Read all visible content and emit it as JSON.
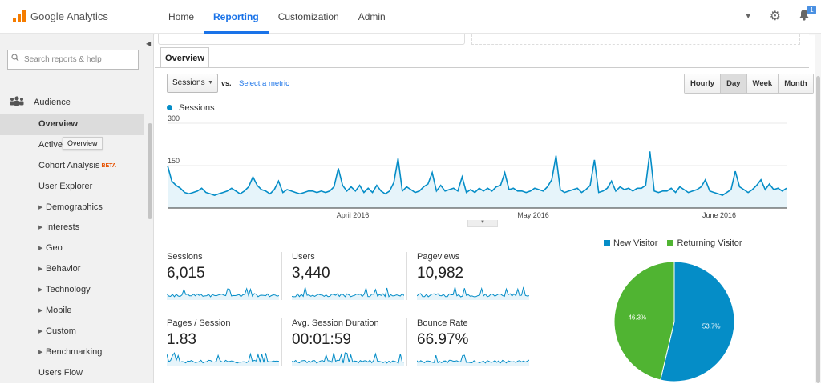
{
  "app": {
    "logo_text": "Google Analytics"
  },
  "nav": [
    {
      "label": "Home",
      "active": false
    },
    {
      "label": "Reporting",
      "active": true
    },
    {
      "label": "Customization",
      "active": false
    },
    {
      "label": "Admin",
      "active": false
    }
  ],
  "header": {
    "notification_count": "1"
  },
  "sidebar": {
    "search_placeholder": "Search reports & help",
    "section": "Audience",
    "items": [
      {
        "label": "Overview",
        "selected": true,
        "expandable": false
      },
      {
        "label": "Active",
        "selected": false,
        "expandable": false
      },
      {
        "label": "Cohort Analysis",
        "badge": "BETA",
        "selected": false,
        "expandable": false
      },
      {
        "label": "User Explorer",
        "selected": false,
        "expandable": false
      },
      {
        "label": "Demographics",
        "selected": false,
        "expandable": true
      },
      {
        "label": "Interests",
        "selected": false,
        "expandable": true
      },
      {
        "label": "Geo",
        "selected": false,
        "expandable": true
      },
      {
        "label": "Behavior",
        "selected": false,
        "expandable": true
      },
      {
        "label": "Technology",
        "selected": false,
        "expandable": true
      },
      {
        "label": "Mobile",
        "selected": false,
        "expandable": true
      },
      {
        "label": "Custom",
        "selected": false,
        "expandable": true
      },
      {
        "label": "Benchmarking",
        "selected": false,
        "expandable": true
      },
      {
        "label": "Users Flow",
        "selected": false,
        "expandable": false
      }
    ],
    "tooltip": "Overview"
  },
  "report": {
    "tab": "Overview",
    "metric_select": "Sessions",
    "vs_label": "vs.",
    "select_metric_link": "Select a metric",
    "periods": [
      {
        "label": "Hourly",
        "active": false
      },
      {
        "label": "Day",
        "active": true
      },
      {
        "label": "Week",
        "active": false
      },
      {
        "label": "Month",
        "active": false
      }
    ],
    "legend": "Sessions"
  },
  "chart_data": [
    {
      "type": "area",
      "series": [
        {
          "name": "Sessions",
          "values": [
            150,
            95,
            80,
            70,
            55,
            50,
            55,
            60,
            70,
            55,
            50,
            45,
            50,
            55,
            60,
            70,
            60,
            50,
            60,
            75,
            110,
            80,
            65,
            60,
            50,
            65,
            95,
            55,
            65,
            60,
            55,
            50,
            55,
            60,
            60,
            55,
            60,
            55,
            60,
            75,
            140,
            80,
            60,
            75,
            60,
            80,
            55,
            70,
            55,
            80,
            60,
            50,
            60,
            90,
            175,
            60,
            75,
            65,
            55,
            60,
            75,
            85,
            125,
            60,
            80,
            60,
            65,
            70,
            60,
            110,
            55,
            65,
            55,
            70,
            60,
            70,
            60,
            75,
            80,
            125,
            65,
            70,
            60,
            60,
            55,
            60,
            70,
            65,
            60,
            75,
            100,
            185,
            65,
            55,
            60,
            65,
            70,
            55,
            65,
            80,
            170,
            55,
            60,
            70,
            95,
            60,
            75,
            65,
            70,
            60,
            70,
            70,
            80,
            200,
            60,
            55,
            60,
            60,
            70,
            55,
            75,
            65,
            55,
            60,
            65,
            75,
            100,
            60,
            55,
            50,
            45,
            55,
            65,
            130,
            75,
            65,
            55,
            65,
            80,
            100,
            65,
            85,
            65,
            70,
            60,
            70
          ]
        }
      ],
      "ylim": [
        0,
        300
      ],
      "yticks": [
        "300",
        "150"
      ],
      "x_tick_labels": [
        "April 2016",
        "May 2016",
        "June 2016"
      ],
      "legend": "top-left"
    },
    {
      "type": "pie",
      "categories": [
        "New Visitor",
        "Returning Visitor"
      ],
      "values": [
        53.7,
        46.3
      ],
      "labels": [
        "53.7%",
        "46.3%"
      ],
      "colors": [
        "#058dc7",
        "#50b432"
      ],
      "legend": "top"
    }
  ],
  "metrics": [
    {
      "label": "Sessions",
      "value": "6,015"
    },
    {
      "label": "Users",
      "value": "3,440"
    },
    {
      "label": "Pageviews",
      "value": "10,982"
    },
    {
      "label": "Pages / Session",
      "value": "1.83"
    },
    {
      "label": "Avg. Session Duration",
      "value": "00:01:59"
    },
    {
      "label": "Bounce Rate",
      "value": "66.97%"
    }
  ],
  "colors": {
    "accent": "#1a73e8",
    "series": "#058dc7",
    "series_fill": "#e6f4fa",
    "returning": "#50b432",
    "logo": "#f57c00"
  }
}
